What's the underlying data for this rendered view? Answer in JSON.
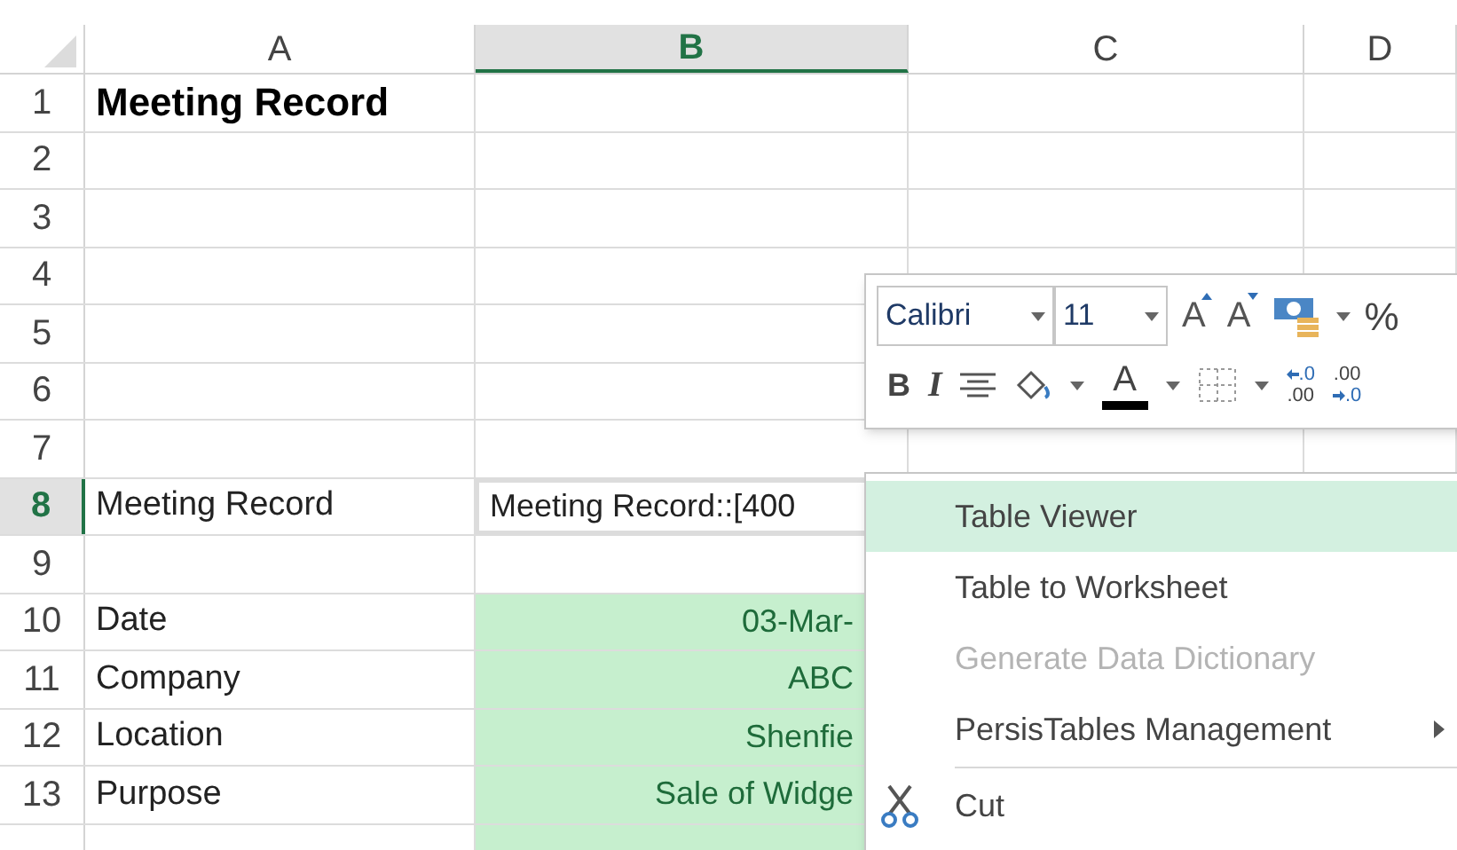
{
  "columns": [
    {
      "label": "A",
      "selected": false
    },
    {
      "label": "B",
      "selected": true
    },
    {
      "label": "C",
      "selected": false
    },
    {
      "label": "D",
      "selected": false
    }
  ],
  "rows": [
    {
      "number": "1",
      "selected": false,
      "a": "Meeting Record",
      "a_bold": true,
      "b": ""
    },
    {
      "number": "2",
      "selected": false,
      "a": "",
      "b": ""
    },
    {
      "number": "3",
      "selected": false,
      "a": "",
      "b": ""
    },
    {
      "number": "4",
      "selected": false,
      "a": "",
      "b": ""
    },
    {
      "number": "5",
      "selected": false,
      "a": "",
      "b": ""
    },
    {
      "number": "6",
      "selected": false,
      "a": "",
      "b": ""
    },
    {
      "number": "7",
      "selected": false,
      "a": "",
      "b": ""
    },
    {
      "number": "8",
      "selected": true,
      "a": "Meeting Record",
      "b": "Meeting Record::[400",
      "b_active": true
    },
    {
      "number": "9",
      "selected": false,
      "a": "",
      "b": ""
    },
    {
      "number": "10",
      "selected": false,
      "a": "Date",
      "b": "03-Mar-",
      "b_fill": true
    },
    {
      "number": "11",
      "selected": false,
      "a": "Company",
      "b": "ABC",
      "b_fill": true
    },
    {
      "number": "12",
      "selected": false,
      "a": "Location",
      "b": "Shenfie",
      "b_fill": true
    },
    {
      "number": "13",
      "selected": false,
      "a": "Purpose",
      "b": "Sale of Widge",
      "b_fill": true
    },
    {
      "number": "",
      "selected": false,
      "a": "",
      "b": "",
      "b_fill": true
    }
  ],
  "mini_toolbar": {
    "font": "Calibri",
    "size": "11",
    "grow_font": "A",
    "shrink_font": "A",
    "percent": "%",
    "bold": "B",
    "italic": "I",
    "font_color": "A",
    "increase_decimal": [
      ".0",
      ".00"
    ],
    "decrease_decimal": [
      ".00",
      ".0"
    ]
  },
  "context_menu": [
    {
      "label": "Table Viewer",
      "selected": true,
      "disabled": false,
      "submenu": false
    },
    {
      "label": "Table to Worksheet",
      "selected": false,
      "disabled": false,
      "submenu": false
    },
    {
      "label": "Generate Data Dictionary",
      "selected": false,
      "disabled": true,
      "submenu": false
    },
    {
      "label": "PersisTables Management",
      "selected": false,
      "disabled": false,
      "submenu": true
    },
    {
      "kind": "separator"
    },
    {
      "label": "Cut",
      "selected": false,
      "disabled": false,
      "submenu": false,
      "kind": "cut"
    }
  ]
}
